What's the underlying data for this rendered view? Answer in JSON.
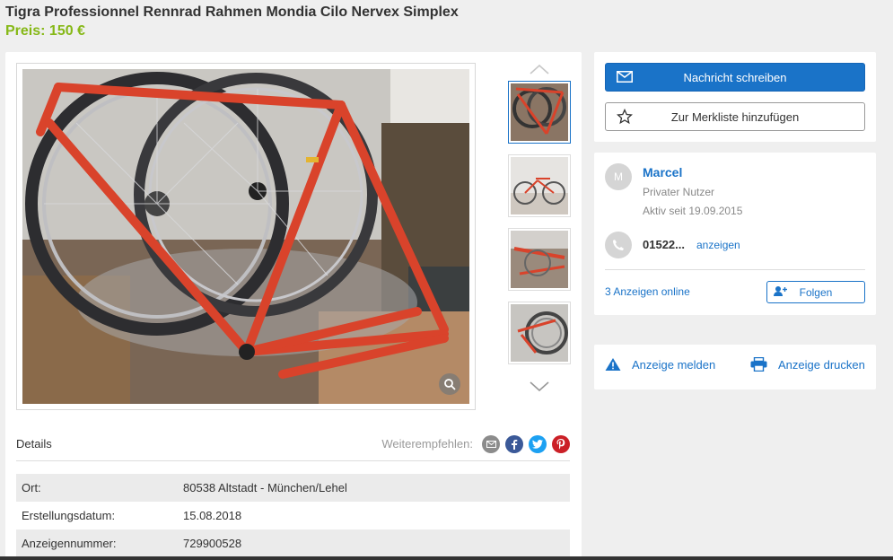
{
  "listing": {
    "title": "Tigra Professionnel Rennrad Rahmen Mondia Cilo Nervex Simplex",
    "price": "Preis: 150 €"
  },
  "details": {
    "label": "Details",
    "share_label": "Weiterempfehlen:",
    "share_icons": [
      "email-icon",
      "facebook-icon",
      "twitter-icon",
      "pinterest-icon"
    ],
    "rows": [
      {
        "key": "Ort:",
        "value": "80538 Altstadt - München/Lehel"
      },
      {
        "key": "Erstellungsdatum:",
        "value": "15.08.2018"
      },
      {
        "key": "Anzeigennummer:",
        "value": "729900528"
      }
    ]
  },
  "contact": {
    "message_label": "Nachricht schreiben",
    "watchlist_label": "Zur Merkliste hinzufügen"
  },
  "seller": {
    "initial": "M",
    "name": "Marcel",
    "type": "Privater Nutzer",
    "active_since": "Aktiv seit 19.09.2015",
    "phone": "01522...",
    "phone_show": "anzeigen",
    "ads_online": "3 Anzeigen online",
    "follow_label": "Folgen"
  },
  "actions": {
    "report_label": "Anzeige melden",
    "print_label": "Anzeige drucken"
  },
  "colors": {
    "accent": "#1a73c8",
    "price": "#86b817"
  }
}
